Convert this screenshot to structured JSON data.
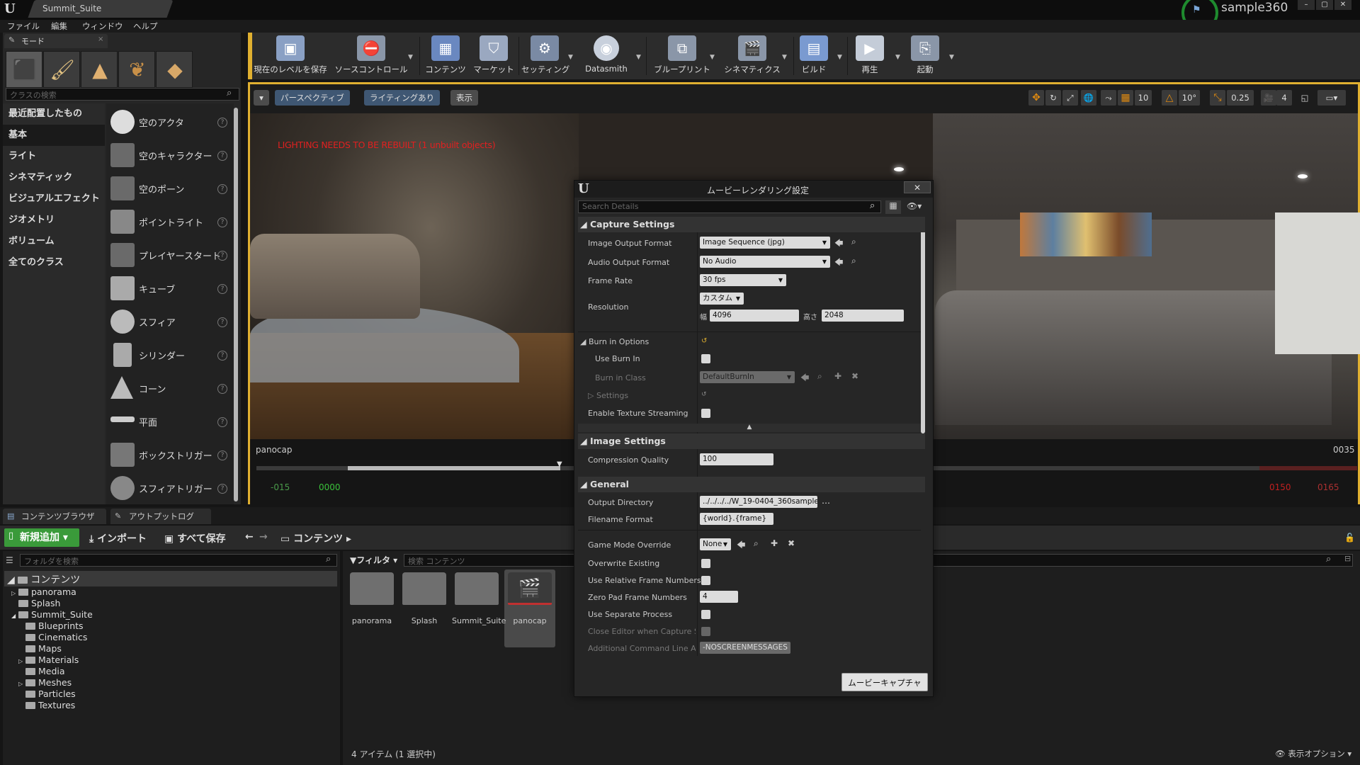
{
  "app": {
    "doc_tab": "Summit_Suite",
    "project": "sample360",
    "menus": [
      "ファイル",
      "編集",
      "ウィンドウ",
      "ヘルプ"
    ],
    "window_buttons": [
      "–",
      "▢",
      "✕"
    ]
  },
  "modes": {
    "tab_label": "モード",
    "search_placeholder": "クラスの検索",
    "categories": [
      "最近配置したもの",
      "基本",
      "ライト",
      "シネマティック",
      "ビジュアルエフェクト",
      "ジオメトリ",
      "ボリューム",
      "全てのクラス"
    ],
    "active_category": "基本",
    "items": [
      "空のアクタ",
      "空のキャラクター",
      "空のポーン",
      "ポイントライト",
      "プレイヤースタート",
      "キューブ",
      "スフィア",
      "シリンダー",
      "コーン",
      "平面",
      "ボックストリガー",
      "スフィアトリガー"
    ]
  },
  "toolbar": {
    "buttons": [
      {
        "label": "現在のレベルを保存",
        "icon": "save-icon"
      },
      {
        "label": "ソースコントロール",
        "icon": "source-control-icon"
      },
      {
        "label": "コンテンツ",
        "icon": "content-icon"
      },
      {
        "label": "マーケット",
        "icon": "marketplace-icon"
      },
      {
        "label": "セッティング",
        "icon": "settings-icon"
      },
      {
        "label": "Datasmith",
        "icon": "datasmith-icon"
      },
      {
        "label": "ブループリント",
        "icon": "blueprint-icon"
      },
      {
        "label": "シネマティクス",
        "icon": "cinematics-icon"
      },
      {
        "label": "ビルド",
        "icon": "build-icon"
      },
      {
        "label": "再生",
        "icon": "play-icon"
      },
      {
        "label": "起動",
        "icon": "launch-icon"
      }
    ]
  },
  "viewport": {
    "perspective": "パースペクティブ",
    "lighting": "ライティングあり",
    "show": "表示",
    "warning": "LIGHTING NEEDS TO BE REBUILT (1 unbuilt objects)",
    "grid_snap": "10",
    "rot_snap": "10°",
    "scale_snap": "0.25",
    "cam_speed": "4",
    "sequence_name": "panocap",
    "seq_end": "0035",
    "seq_start_out": "-015",
    "seq_start_in": "0000",
    "seq_end_in": "0150",
    "seq_end_out": "0165"
  },
  "lower_tabs": {
    "content_browser": "コンテンツブラウザ",
    "output_log": "アウトプットログ"
  },
  "content_browser": {
    "add_new": "新規追加",
    "import": "インポート",
    "save_all": "すべて保存",
    "path": "コンテンツ",
    "folder_search_placeholder": "フォルダを検索",
    "filter": "フィルタ",
    "asset_search_placeholder": "検索 コンテンツ",
    "tree_root": "コンテンツ",
    "tree": [
      {
        "label": "panorama",
        "depth": 1,
        "expander": "▷"
      },
      {
        "label": "Splash",
        "depth": 1,
        "expander": ""
      },
      {
        "label": "Summit_Suite",
        "depth": 1,
        "expander": "◢"
      },
      {
        "label": "Blueprints",
        "depth": 2,
        "expander": ""
      },
      {
        "label": "Cinematics",
        "depth": 2,
        "expander": ""
      },
      {
        "label": "Maps",
        "depth": 2,
        "expander": ""
      },
      {
        "label": "Materials",
        "depth": 2,
        "expander": "▷"
      },
      {
        "label": "Media",
        "depth": 2,
        "expander": ""
      },
      {
        "label": "Meshes",
        "depth": 2,
        "expander": "▷"
      },
      {
        "label": "Particles",
        "depth": 2,
        "expander": ""
      },
      {
        "label": "Textures",
        "depth": 2,
        "expander": ""
      }
    ],
    "assets": [
      "panorama",
      "Splash",
      "Summit_Suite",
      "panocap"
    ],
    "selected_asset": "panocap",
    "count": "4 アイテム (1 選択中)",
    "view_options": "表示オプション"
  },
  "dialog": {
    "title": "ムービーレンダリング設定",
    "search_placeholder": "Search Details",
    "capture_settings": "Capture Settings",
    "image_output_format_label": "Image Output Format",
    "image_output_format": "Image Sequence (jpg)",
    "audio_output_format_label": "Audio Output Format",
    "audio_output_format": "No Audio",
    "frame_rate_label": "Frame Rate",
    "frame_rate": "30 fps",
    "resolution_label": "Resolution",
    "resolution_preset": "カスタム",
    "width_label": "幅",
    "width": "4096",
    "height_label": "高さ",
    "height": "2048",
    "burn_in_options": "Burn in Options",
    "use_burn_in": "Use Burn In",
    "burn_in_class_label": "Burn in Class",
    "burn_in_class": "DefaultBurnIn",
    "settings": "Settings",
    "enable_texture_streaming": "Enable Texture Streaming",
    "image_settings": "Image Settings",
    "compression_quality_label": "Compression Quality",
    "compression_quality": "100",
    "general": "General",
    "output_directory_label": "Output Directory",
    "output_directory": "../../../../W_19-0404_360sample",
    "filename_format_label": "Filename Format",
    "filename_format": "{world}.{frame}",
    "game_mode_override_label": "Game Mode Override",
    "game_mode_override": "None",
    "overwrite_existing": "Overwrite Existing",
    "use_relative_frame_numbers": "Use Relative Frame Numbers",
    "zero_pad_label": "Zero Pad Frame Numbers",
    "zero_pad": "4",
    "use_separate_process": "Use Separate Process",
    "close_editor": "Close Editor when Capture Sta",
    "additional_cmd_label": "Additional Command Line Argu",
    "additional_cmd": "-NOSCREENMESSAGES",
    "capture_button": "ムービーキャプチャ"
  }
}
